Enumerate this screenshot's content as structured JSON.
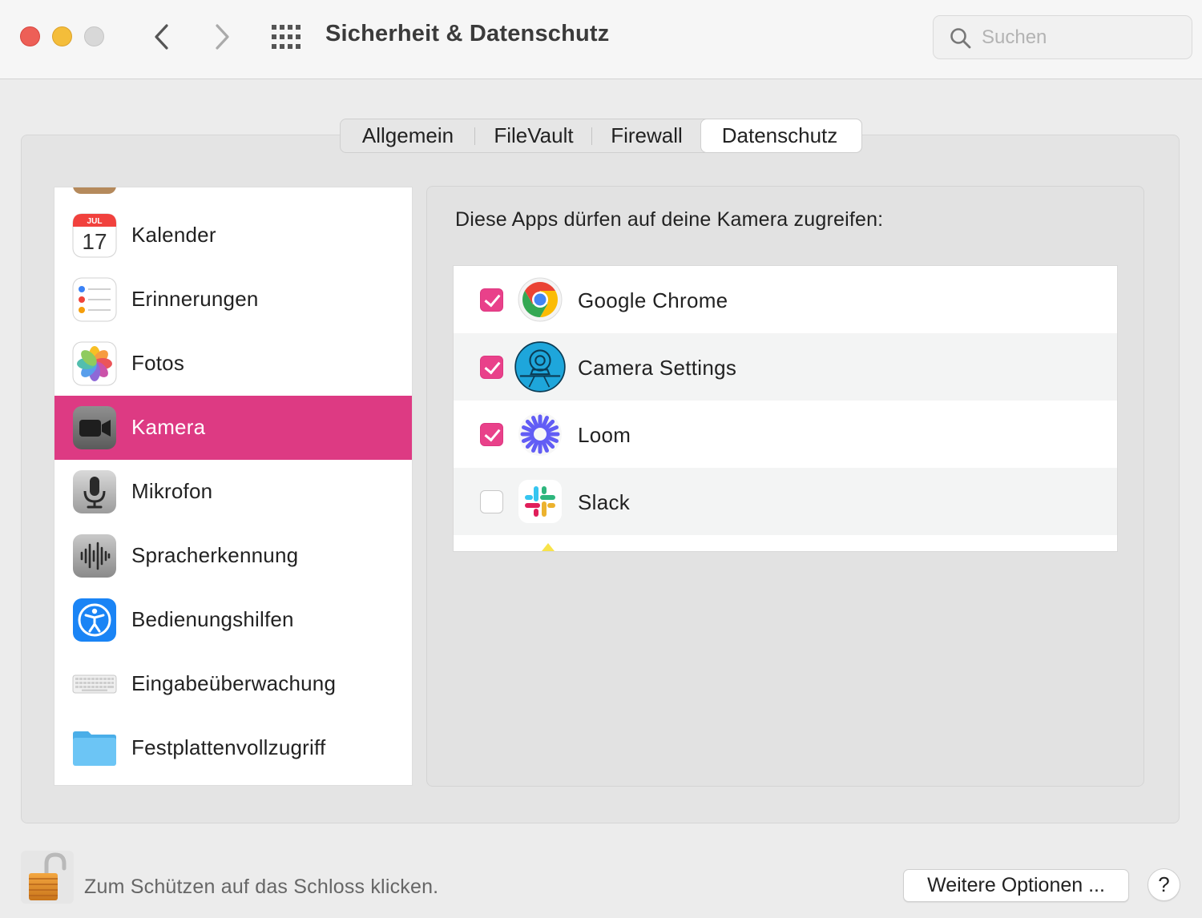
{
  "window": {
    "title": "Sicherheit & Datenschutz",
    "search": {
      "placeholder": "Suchen",
      "value": ""
    }
  },
  "tabs": [
    {
      "label": "Allgemein",
      "selected": false
    },
    {
      "label": "FileVault",
      "selected": false
    },
    {
      "label": "Firewall",
      "selected": false
    },
    {
      "label": "Datenschutz",
      "selected": true
    }
  ],
  "sidebar": {
    "items": [
      {
        "label": "Kalender",
        "icon": "calendar-icon",
        "selected": false,
        "icon_text": {
          "month": "JUL",
          "day": "17"
        }
      },
      {
        "label": "Erinnerungen",
        "icon": "reminders-icon",
        "selected": false
      },
      {
        "label": "Fotos",
        "icon": "photos-icon",
        "selected": false
      },
      {
        "label": "Kamera",
        "icon": "camera-icon",
        "selected": true
      },
      {
        "label": "Mikrofon",
        "icon": "microphone-icon",
        "selected": false
      },
      {
        "label": "Spracherkennung",
        "icon": "speech-recognition-icon",
        "selected": false
      },
      {
        "label": "Bedienungshilfen",
        "icon": "accessibility-icon",
        "selected": false
      },
      {
        "label": "Eingabeüberwachung",
        "icon": "keyboard-icon",
        "selected": false
      },
      {
        "label": "Festplattenvollzugriff",
        "icon": "folder-icon",
        "selected": false
      }
    ]
  },
  "main": {
    "heading": "Diese Apps dürfen auf deine Kamera zugreifen:",
    "apps": [
      {
        "label": "Google Chrome",
        "icon": "chrome-icon",
        "checked": true
      },
      {
        "label": "Camera Settings",
        "icon": "camera-settings-icon",
        "checked": true
      },
      {
        "label": "Loom",
        "icon": "loom-icon",
        "checked": true
      },
      {
        "label": "Slack",
        "icon": "slack-icon",
        "checked": false
      }
    ]
  },
  "footer": {
    "lock_text": "Zum Schützen auf das Schloss klicken.",
    "more_options": "Weitere Optionen ...",
    "help": "?"
  },
  "colors": {
    "accent": "#dd3a83",
    "checkbox_on": "#e9418a",
    "traffic_close": "#ed5f57",
    "traffic_minimize": "#f4bd3a",
    "traffic_zoom": "#d8d8d8"
  }
}
